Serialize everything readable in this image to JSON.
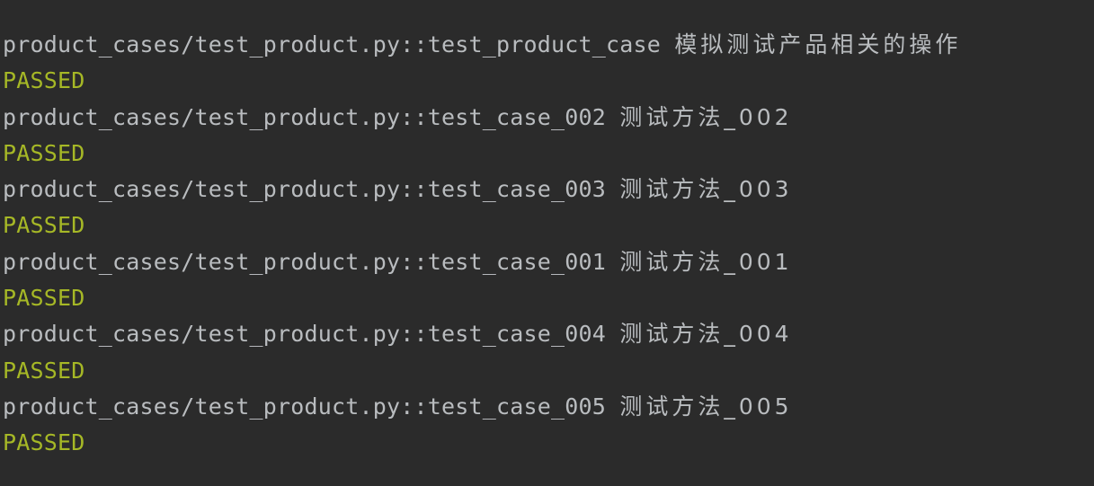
{
  "colors": {
    "background": "#2b2b2b",
    "test_text": "#b9bcbf",
    "passed": "#a6b826"
  },
  "results": [
    {
      "test": "product_cases/test_product.py::test_product_case",
      "description": "模拟测试产品相关的操作",
      "status": "PASSED"
    },
    {
      "test": "product_cases/test_product.py::test_case_002",
      "description": "测试方法_002",
      "status": "PASSED"
    },
    {
      "test": "product_cases/test_product.py::test_case_003",
      "description": "测试方法_003",
      "status": "PASSED"
    },
    {
      "test": "product_cases/test_product.py::test_case_001",
      "description": "测试方法_001",
      "status": "PASSED"
    },
    {
      "test": "product_cases/test_product.py::test_case_004",
      "description": "测试方法_004",
      "status": "PASSED"
    },
    {
      "test": "product_cases/test_product.py::test_case_005",
      "description": "测试方法_005",
      "status": "PASSED"
    }
  ]
}
